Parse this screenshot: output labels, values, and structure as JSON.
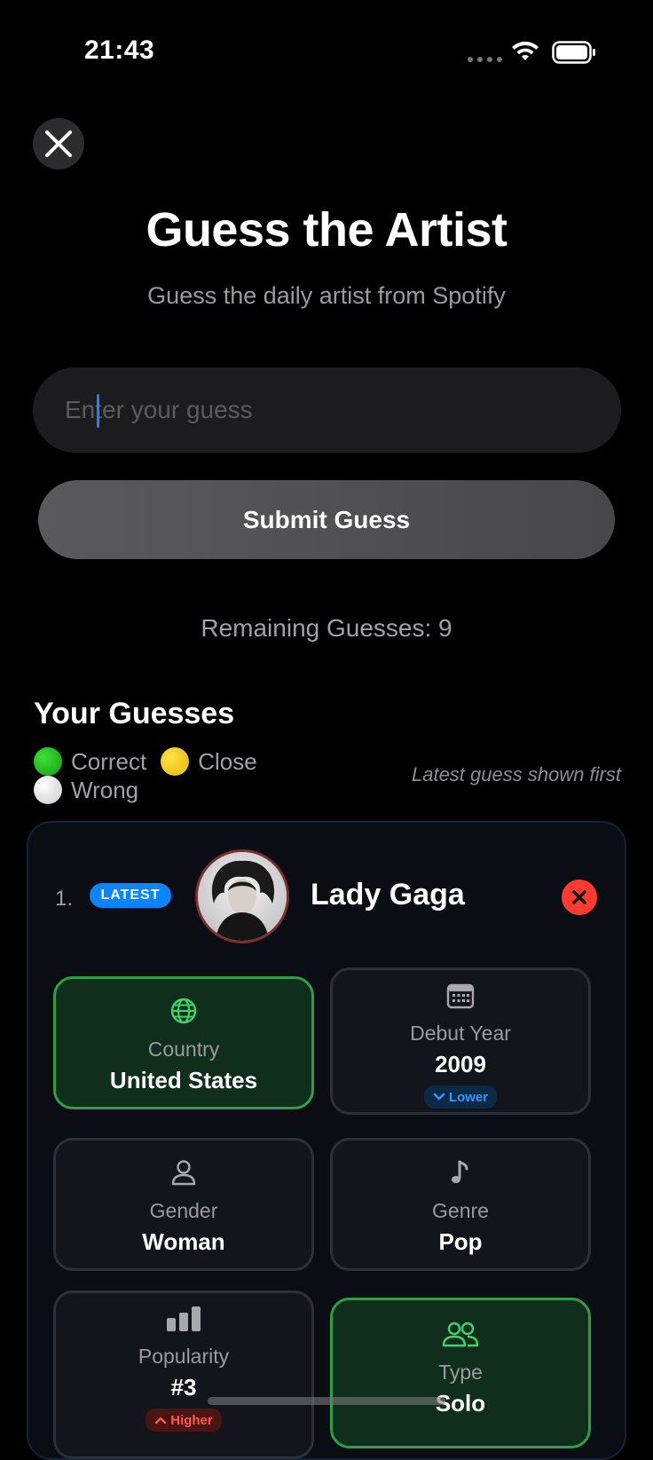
{
  "status_bar": {
    "time": "21:43"
  },
  "header": {
    "title": "Guess the Artist",
    "subtitle": "Guess the daily artist from Spotify"
  },
  "guess_input": {
    "placeholder": "Enter your guess",
    "value": ""
  },
  "submit_button": {
    "label": "Submit Guess"
  },
  "remaining": {
    "text": "Remaining Guesses: 9"
  },
  "guesses_section": {
    "title": "Your Guesses",
    "legend": {
      "correct": "Correct",
      "close": "Close",
      "wrong": "Wrong"
    },
    "order_note": "Latest guess shown first"
  },
  "guesses": [
    {
      "number": "1.",
      "badge": "LATEST",
      "artist": "Lady Gaga",
      "attributes": {
        "country": {
          "label": "Country",
          "value": "United States",
          "status": "correct",
          "icon": "globe-icon"
        },
        "debut_year": {
          "label": "Debut Year",
          "value": "2009",
          "status": "wrong",
          "hint": "Lower",
          "icon": "calendar-icon"
        },
        "gender": {
          "label": "Gender",
          "value": "Woman",
          "status": "wrong",
          "icon": "person-icon"
        },
        "genre": {
          "label": "Genre",
          "value": "Pop",
          "status": "wrong",
          "icon": "music-note-icon"
        },
        "popularity": {
          "label": "Popularity",
          "value": "#3",
          "status": "wrong",
          "hint": "Higher",
          "icon": "bar-chart-icon"
        },
        "type": {
          "label": "Type",
          "value": "Solo",
          "status": "correct",
          "icon": "people-icon"
        }
      }
    }
  ],
  "colors": {
    "correct": "#2ea043",
    "close": "#e4b800",
    "wrong": "#c9c9cc",
    "accent": "#0a84ff",
    "error": "#ff3b30"
  }
}
